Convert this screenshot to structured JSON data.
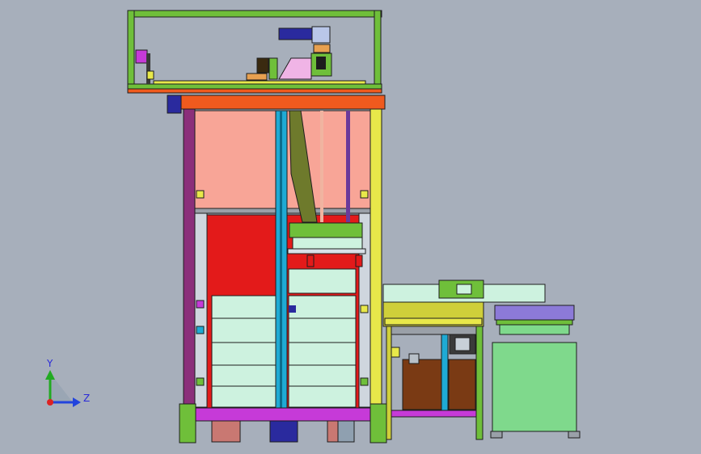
{
  "viewport": {
    "background": "#a7afbb",
    "triad": {
      "y_label": "Y",
      "z_label": "Z",
      "y_color": "#22aa22",
      "z_color": "#2244dd",
      "origin_color": "#dd2222"
    }
  },
  "colors": {
    "frame_green": "#6fbf3a",
    "frame_dark": "#1d1d1d",
    "post_purple": "#8b2f7a",
    "post_yellow": "#e8e84a",
    "post_cyan": "#1faad4",
    "beam_orange": "#f05a1e",
    "beam_magenta": "#c63ad8",
    "panel_salmon": "#f8a597",
    "panel_red": "#e31a1a",
    "panel_mint": "#cdf2df",
    "panel_lime": "#7fd98c",
    "conveyor_olive": "#cfcf3a",
    "brown": "#7a3a14",
    "base_pink": "#c97872",
    "violet": "#8c7ad8",
    "navy": "#2a2a9e"
  }
}
